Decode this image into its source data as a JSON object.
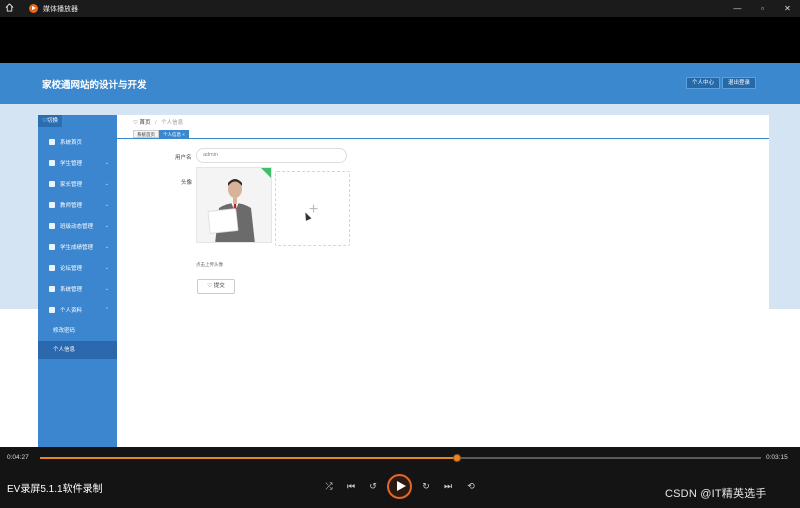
{
  "player": {
    "title": "媒体播放器",
    "icons": [
      "home-icon",
      "player-logo-icon",
      "minimize-icon",
      "maximize-icon",
      "close-icon"
    ],
    "accent": "#e58628"
  },
  "site": {
    "title": "家校通网站的设计与开发",
    "header_buttons": [
      "个人中心",
      "退出登录"
    ],
    "header_color": "#3b88ce"
  },
  "sidebar": {
    "toggle": "切换",
    "items": [
      {
        "label": "系统首页",
        "icon": "home-icon",
        "expandable": false
      },
      {
        "label": "学生管理",
        "icon": "user-icon",
        "expandable": true
      },
      {
        "label": "家长管理",
        "icon": "grid-icon",
        "expandable": true
      },
      {
        "label": "教师管理",
        "icon": "grid-icon",
        "expandable": true
      },
      {
        "label": "班级动态管理",
        "icon": "grid-icon",
        "expandable": true
      },
      {
        "label": "学生成绩管理",
        "icon": "grid-icon",
        "expandable": true
      },
      {
        "label": "论坛管理",
        "icon": "chat-icon",
        "expandable": true
      },
      {
        "label": "系统管理",
        "icon": "chart-icon",
        "expandable": true
      },
      {
        "label": "个人资料",
        "icon": "doc-icon",
        "expandable": true
      }
    ],
    "sub_items": [
      {
        "label": "修改密码",
        "active": false
      },
      {
        "label": "个人信息",
        "active": true
      }
    ]
  },
  "breadcrumb": {
    "home": "首页",
    "current": "个人信息"
  },
  "tabs": [
    {
      "label": "系统首页",
      "active": false
    },
    {
      "label": "个人信息 ×",
      "active": true
    }
  ],
  "form": {
    "username_label": "用户名",
    "username_value": "admin",
    "avatar_label": "头像",
    "upload_hint": "点击上传头像",
    "submit_label": "提交",
    "upload_plus": "+"
  },
  "playback": {
    "elapsed": "0:04:27",
    "duration": "0:03:15",
    "progress": 0.578,
    "recorder_brand": "EV录屏5.1.1软件录制"
  },
  "watermark": "CSDN @IT精英选手"
}
